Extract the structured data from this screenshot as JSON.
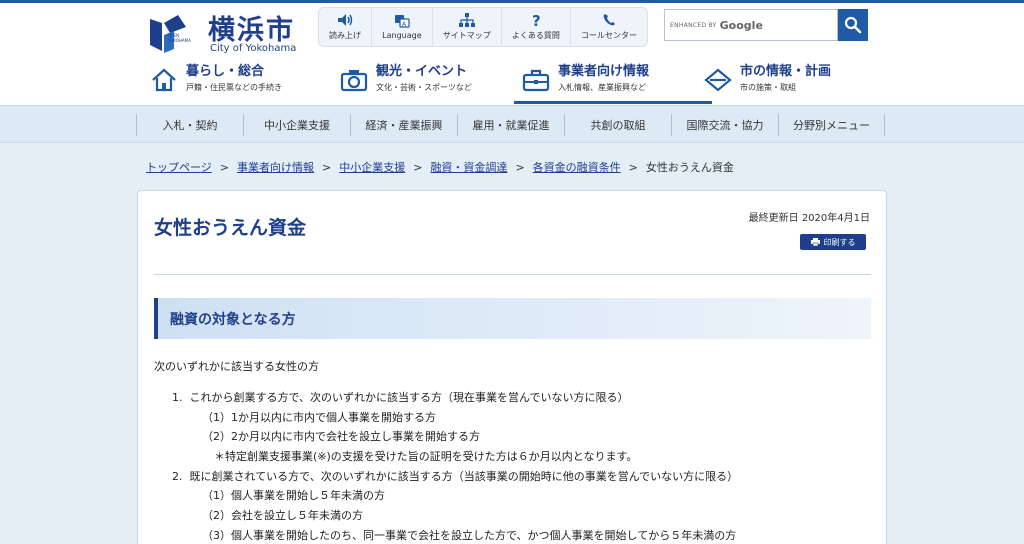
{
  "header": {
    "logo_jp": "横浜市",
    "logo_en": "City of Yokohama",
    "logo_badge_lines": [
      "OPEN",
      "YOKOHAMA"
    ],
    "utility_nav": [
      {
        "label": "読み上げ",
        "icon": "speaker-icon"
      },
      {
        "label": "Language",
        "icon": "translate-icon"
      },
      {
        "label": "サイトマップ",
        "icon": "sitemap-icon"
      },
      {
        "label": "よくある質問",
        "icon": "question-icon"
      },
      {
        "label": "コールセンター",
        "icon": "phone-icon"
      }
    ],
    "search": {
      "enhanced_by": "ENHANCED BY",
      "provider": "Google",
      "button_icon": "search-icon"
    },
    "main_nav": [
      {
        "title": "暮らし・総合",
        "sub": "戸籍・住民票などの手続き",
        "icon": "house-icon",
        "active": false
      },
      {
        "title": "観光・イベント",
        "sub": "文化・芸術・スポーツなど",
        "icon": "camera-icon",
        "active": false
      },
      {
        "title": "事業者向け情報",
        "sub": "入札情報、産業振興など",
        "icon": "briefcase-icon",
        "active": true
      },
      {
        "title": "市の情報・計画",
        "sub": "市の施策・取組",
        "icon": "city-emblem-icon",
        "active": false
      }
    ]
  },
  "sub_nav": [
    "入札・契約",
    "中小企業支援",
    "経済・産業振興",
    "雇用・就業促進",
    "共創の取組",
    "国際交流・協力",
    "分野別メニュー"
  ],
  "breadcrumb": {
    "links": [
      "トップページ",
      "事業者向け情報",
      "中小企業支援",
      "融資・資金調達",
      "各資金の融資条件"
    ],
    "separator": ">",
    "current": "女性おうえん資金"
  },
  "article": {
    "title": "女性おうえん資金",
    "last_updated": "最終更新日 2020年4月1日",
    "print_label": "印刷する",
    "section_heading": "融資の対象となる方",
    "intro": "次のいずれかに該当する女性の方",
    "list": [
      {
        "type": "item",
        "num": "1.",
        "text": "これから創業する方で、次のいずれかに該当する方（現在事業を営んでいない方に限る）"
      },
      {
        "type": "sub",
        "text": "（1）1か月以内に市内で個人事業を開始する方"
      },
      {
        "type": "sub",
        "text": "（2）2か月以内に市内で会社を設立し事業を開始する方"
      },
      {
        "type": "note",
        "text": "＊特定創業支援事業(※)の支援を受けた旨の証明を受けた方は６か月以内となります。"
      },
      {
        "type": "item",
        "num": "2.",
        "text": "既に創業されている方で、次のいずれかに該当する方（当該事業の開始時に他の事業を営んでいない方に限る）"
      },
      {
        "type": "sub",
        "text": "（1）個人事業を開始し５年未満の方"
      },
      {
        "type": "sub",
        "text": "（2）会社を設立し５年未満の方"
      },
      {
        "type": "sub",
        "text": "（3）個人事業を開始したのち、同一事業で会社を設立した方で、かつ個人事業を開始してから５年未満の方"
      }
    ]
  },
  "colors": {
    "brand_blue": "#1f3f8c",
    "accent_blue": "#1f5aa6",
    "page_bg": "#e3eef7"
  }
}
